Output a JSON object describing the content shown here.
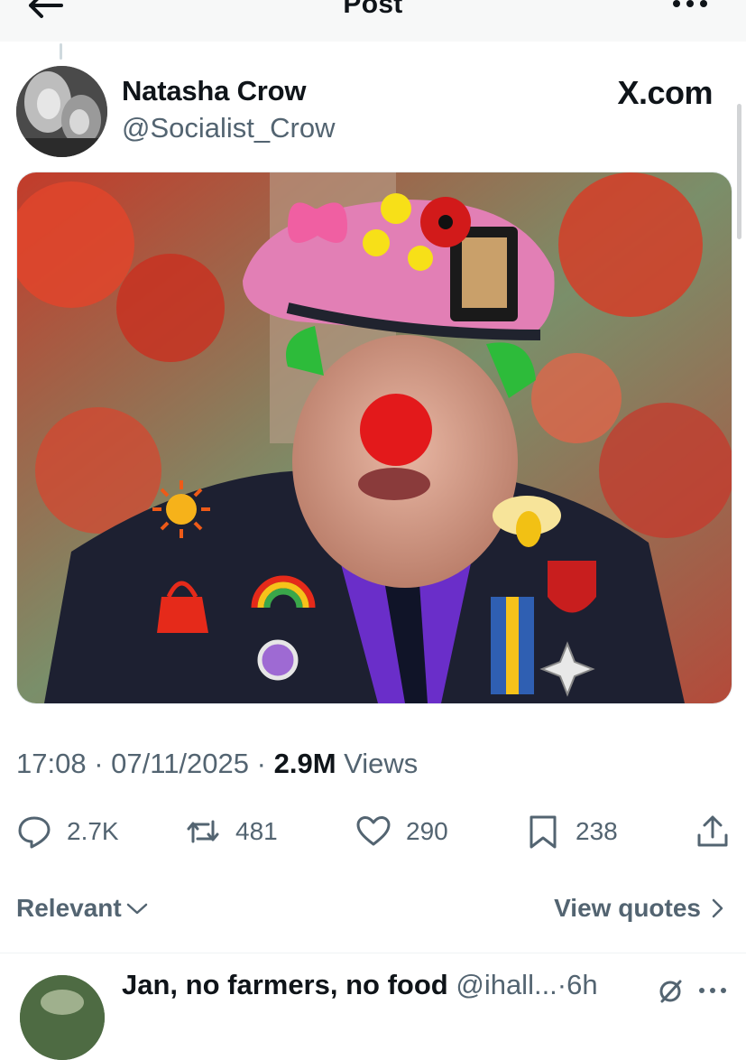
{
  "header": {
    "title": "Post"
  },
  "tweet": {
    "author": {
      "display_name": "Natasha Crow",
      "handle": "@Socialist_Crow"
    },
    "source_badge": "X.com",
    "time": "17:08",
    "date": "07/11/2025",
    "separator": "·",
    "views_count": "2.9M",
    "views_label": "Views",
    "actions": {
      "replies": "2.7K",
      "reposts": "481",
      "likes": "290",
      "bookmarks": "238"
    }
  },
  "replies_filter": {
    "label": "Relevant"
  },
  "view_quotes": {
    "label": "View quotes"
  },
  "next_reply": {
    "display_name": "Jan, no farmers, no food",
    "handle": "@ihall...",
    "time": "6h"
  },
  "icons": [
    "back-arrow-icon",
    "more-icon",
    "reply-icon",
    "repost-icon",
    "like-icon",
    "bookmark-icon",
    "share-icon",
    "chevron-down-icon",
    "chevron-right-icon",
    "grok-icon"
  ],
  "colors": {
    "text_primary": "#0f1419",
    "text_secondary": "#536471",
    "divider": "#eff3f4"
  }
}
